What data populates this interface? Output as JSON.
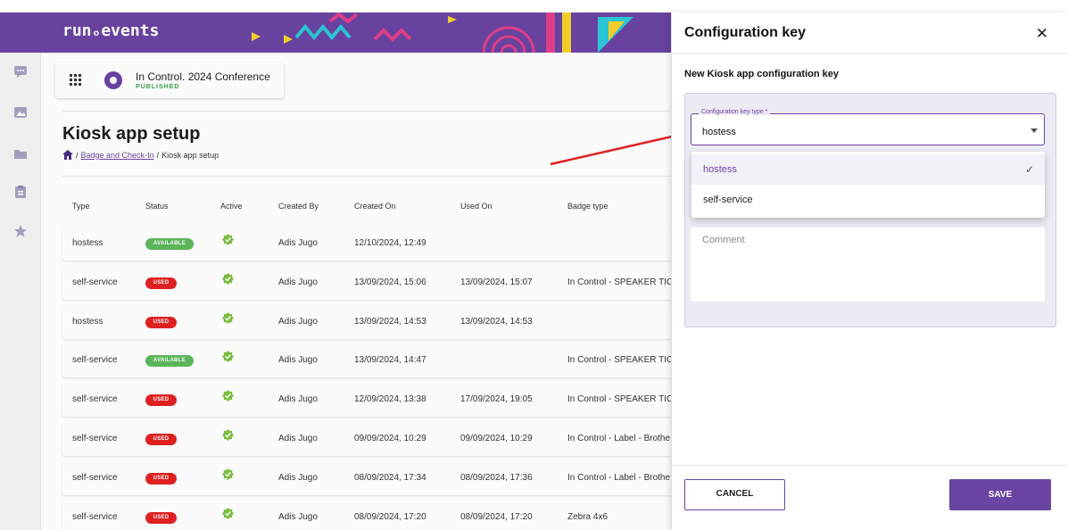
{
  "app": {
    "brand": "runₒevents"
  },
  "sidebar": {
    "icons": [
      "chat-icon",
      "image-icon",
      "folder-icon",
      "clipboard-icon",
      "star-icon"
    ]
  },
  "event": {
    "name": "In Control. 2024 Conference",
    "status": "PUBLISHED"
  },
  "page": {
    "title": "Kiosk app setup",
    "breadcrumb": {
      "separator": "/",
      "link": "Badge and Check-In",
      "current": "Kiosk app setup"
    }
  },
  "table": {
    "columns": [
      "Type",
      "Status",
      "Active",
      "Created By",
      "Created On",
      "Used On",
      "Badge type"
    ],
    "rows": [
      {
        "type": "hostess",
        "status": "AVAILABLE",
        "created_by": "Adis Jugo",
        "created_on": "12/10/2024, 12:49",
        "used_on": "",
        "badge_type": ""
      },
      {
        "type": "self-service",
        "status": "USED",
        "created_by": "Adis Jugo",
        "created_on": "13/09/2024, 15:06",
        "used_on": "13/09/2024, 15:07",
        "badge_type": "In Control - SPEAKER TICK"
      },
      {
        "type": "hostess",
        "status": "USED",
        "created_by": "Adis Jugo",
        "created_on": "13/09/2024, 14:53",
        "used_on": "13/09/2024, 14:53",
        "badge_type": ""
      },
      {
        "type": "self-service",
        "status": "AVAILABLE",
        "created_by": "Adis Jugo",
        "created_on": "13/09/2024, 14:47",
        "used_on": "",
        "badge_type": "In Control - SPEAKER TICK"
      },
      {
        "type": "self-service",
        "status": "USED",
        "created_by": "Adis Jugo",
        "created_on": "12/09/2024, 13:38",
        "used_on": "17/09/2024, 19:05",
        "badge_type": "In Control - SPEAKER TICK"
      },
      {
        "type": "self-service",
        "status": "USED",
        "created_by": "Adis Jugo",
        "created_on": "09/09/2024, 10:29",
        "used_on": "09/09/2024, 10:29",
        "badge_type": "In Control - Label - Brothe"
      },
      {
        "type": "self-service",
        "status": "USED",
        "created_by": "Adis Jugo",
        "created_on": "08/09/2024, 17:34",
        "used_on": "08/09/2024, 17:36",
        "badge_type": "In Control - Label - Brothe"
      },
      {
        "type": "self-service",
        "status": "USED",
        "created_by": "Adis Jugo",
        "created_on": "08/09/2024, 17:20",
        "used_on": "08/09/2024, 17:20",
        "badge_type": "Zebra 4x6"
      }
    ]
  },
  "drawer": {
    "title": "Configuration key",
    "section_title": "New Kiosk app configuration key",
    "type_field": {
      "label": "Configuration key type *",
      "value": "hostess"
    },
    "options": [
      {
        "label": "hostess",
        "selected": true
      },
      {
        "label": "self-service",
        "selected": false
      }
    ],
    "comment_placeholder": "Comment",
    "cancel_label": "CANCEL",
    "save_label": "SAVE"
  },
  "colors": {
    "brand": "#6a44a2",
    "available": "#5cb85c",
    "used": "#e32121",
    "check": "#7cc142"
  }
}
